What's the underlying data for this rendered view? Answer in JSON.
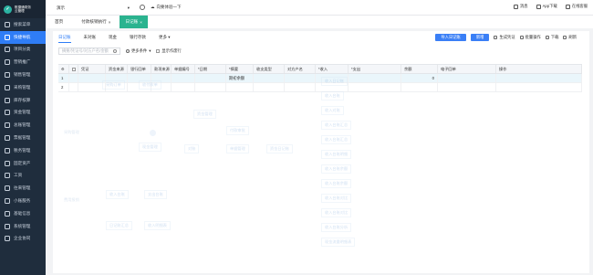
{
  "sidebar": {
    "logo_line1": "账捷通财务",
    "logo_line2": "云管理",
    "items": [
      {
        "label": "搜索菜单"
      },
      {
        "label": "快捷导航"
      },
      {
        "label": "项目分类"
      },
      {
        "label": "营销推广"
      },
      {
        "label": "销售管理"
      },
      {
        "label": "采购管理"
      },
      {
        "label": "库存核算"
      },
      {
        "label": "资金管理"
      },
      {
        "label": "总账管理"
      },
      {
        "label": "票据管理"
      },
      {
        "label": "税务管理"
      },
      {
        "label": "固定资产"
      },
      {
        "label": "工资"
      },
      {
        "label": "往来管理"
      },
      {
        "label": "小账服务"
      },
      {
        "label": "基础信息"
      },
      {
        "label": "系统管理"
      },
      {
        "label": "企业协同"
      }
    ]
  },
  "topbar": {
    "company": "演示",
    "weather_label": "向要体验一下",
    "right_items": [
      {
        "label": "消息"
      },
      {
        "label": "App下载"
      },
      {
        "label": "在线客服"
      }
    ]
  },
  "tabs": [
    {
      "label": "首页"
    },
    {
      "label": "付款核销执行"
    },
    {
      "label": "日记账"
    }
  ],
  "subtabs": [
    {
      "label": "日记账"
    },
    {
      "label": "未对账"
    },
    {
      "label": "现金"
    },
    {
      "label": "银行存款"
    },
    {
      "label": "更多"
    }
  ],
  "actions": {
    "primary1": "导入日记账",
    "primary2": "新增",
    "links": [
      "生成凭证",
      "批量操作",
      "下载",
      "刷新"
    ]
  },
  "toolbar": {
    "search_placeholder": "摘要/凭证号/对方户名/金额",
    "filter_label": "更多条件",
    "checkbox_label": "显示作废行"
  },
  "table": {
    "headers": [
      "",
      "",
      "凭证",
      "资金来源",
      "银行回单",
      "款项来源",
      "单据编号",
      "*日期",
      "*摘要",
      "收支类型",
      "对方户名",
      "*收入",
      "*支出",
      "余额",
      "电子回单",
      "操作"
    ],
    "rows": [
      [
        "1",
        "",
        "",
        "",
        "",
        "",
        "",
        "",
        "期初余额",
        "",
        "",
        "",
        "",
        "0",
        "",
        ""
      ],
      [
        "2",
        "",
        "",
        "",
        "",
        "",
        "",
        "",
        "",
        "",
        "",
        "",
        "",
        "",
        "",
        ""
      ]
    ]
  },
  "watermark": {
    "nodes": [
      "采购订单",
      "收付款单",
      "采购管理",
      "现金管理",
      "资金管理",
      "付款审批",
      "对账",
      "单据管理",
      "资金日记账",
      "银行对账",
      "费用报销",
      "收入台账",
      "支出台账",
      "日记账汇总",
      "收入明细表",
      "支出明细表",
      "余额表",
      "对账单",
      "凭证",
      "资产负债"
    ],
    "right_column": [
      "收入日记账",
      "收入台账",
      "收入对账",
      "收入台账汇总",
      "收入台账汇总",
      "收入台账明细",
      "收入台账余额",
      "收入台账余额",
      "收入台账对比",
      "收入台账对比",
      "收入台账分析",
      "现金流量明细表"
    ]
  }
}
